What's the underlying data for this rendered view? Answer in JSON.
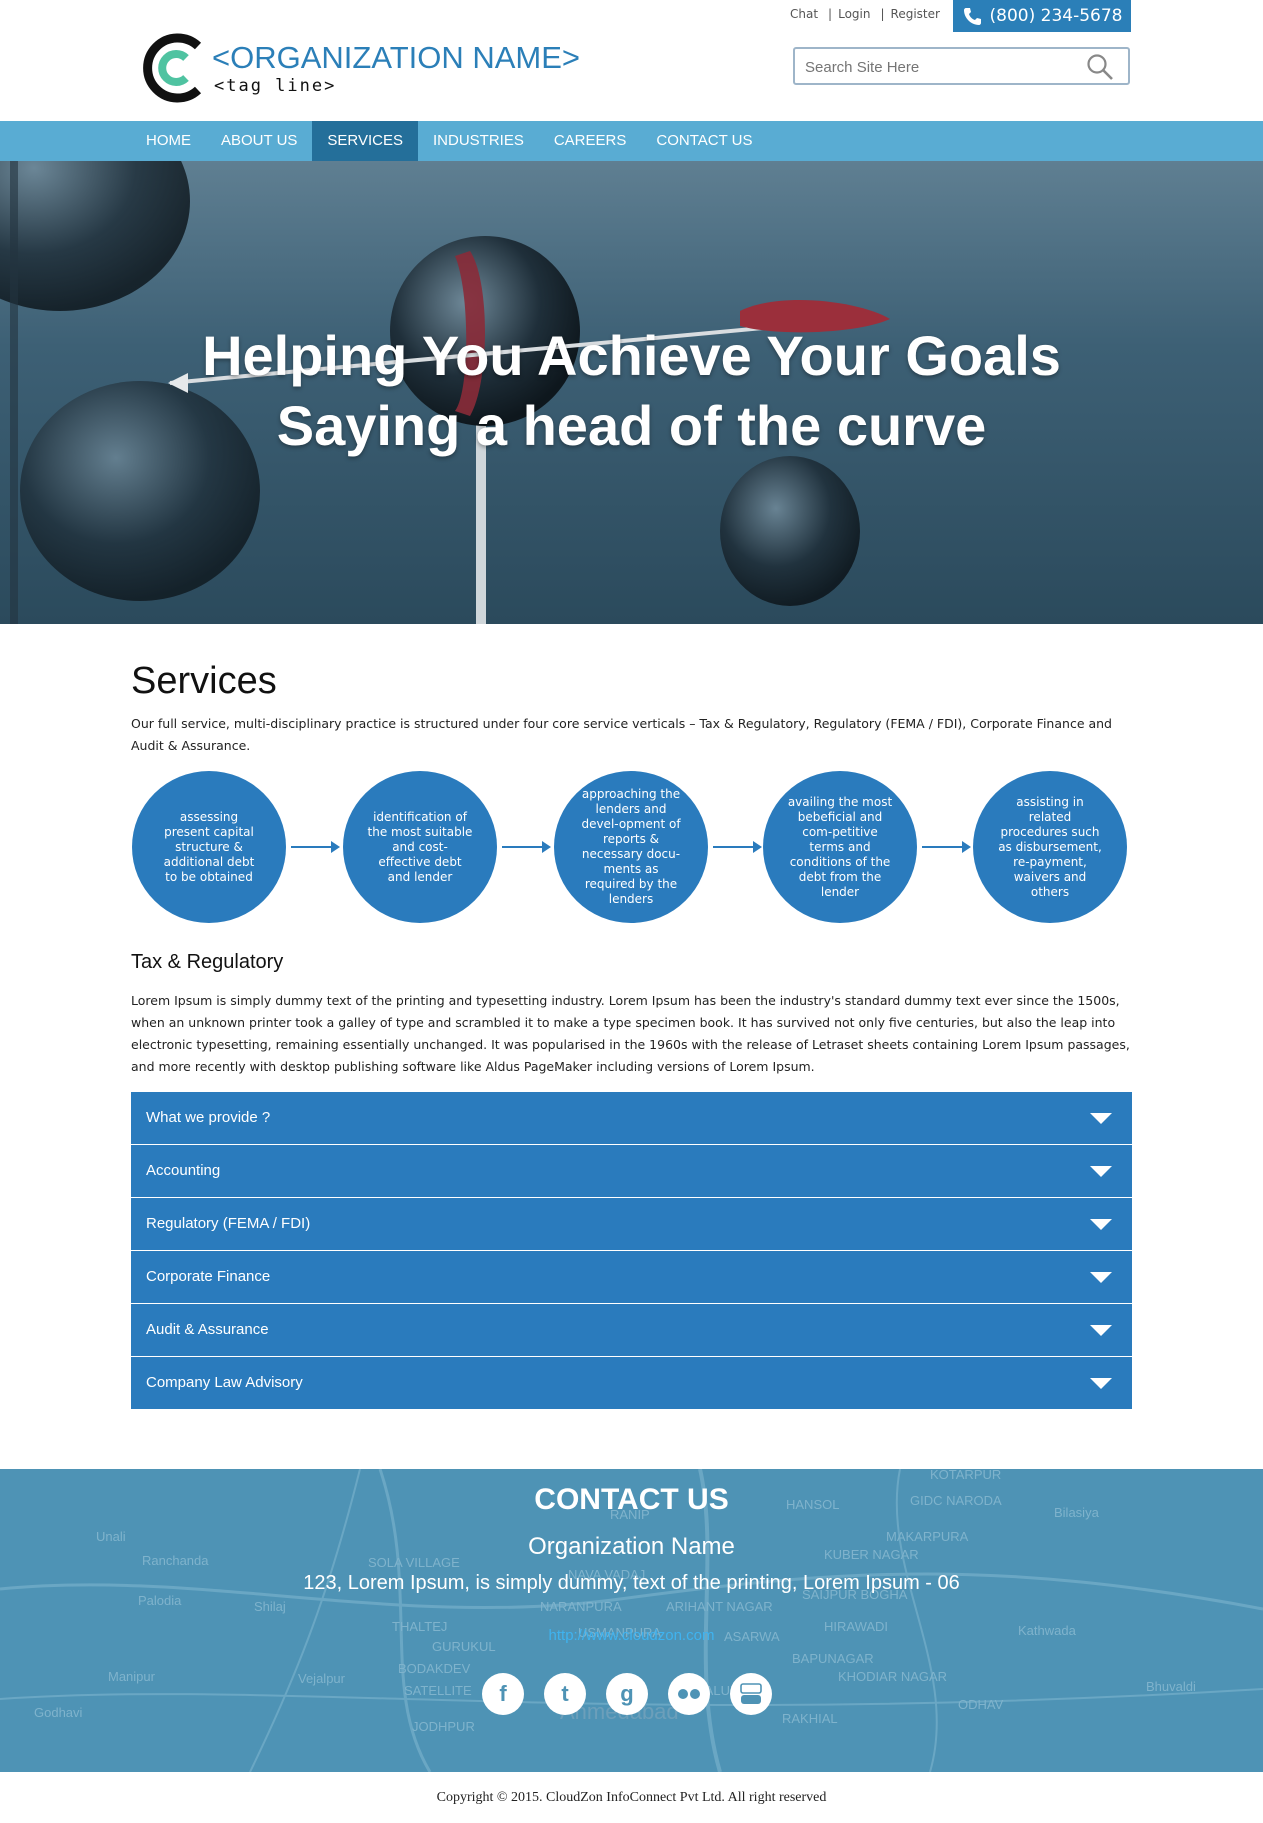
{
  "header": {
    "org_name": "<ORGANIZATION NAME>",
    "tagline": "<tag line>",
    "toplinks": [
      "Chat",
      "Login",
      "Register"
    ],
    "phone": "(800) 234-5678",
    "search_placeholder": "Search Site Here"
  },
  "nav": {
    "items": [
      "HOME",
      "ABOUT US",
      "SERVICES",
      "INDUSTRIES",
      "CAREERS",
      "CONTACT US"
    ],
    "active": "SERVICES"
  },
  "hero": {
    "line1": "Helping You Achieve Your Goals",
    "line2": "Saying a head of the curve"
  },
  "services": {
    "title": "Services",
    "intro": "Our full service, multi-disciplinary practice is structured under four core service verticals – Tax & Regulatory, Regulatory (FEMA / FDI), Corporate Finance and Audit & Assurance.",
    "steps": [
      "assessing present capital structure & additional debt to be obtained",
      "identification of the most suitable and cost-effective debt and lender",
      "approaching the lenders and devel-opment of reports & necessary docu-ments as required by the lenders",
      "availing the most bebeficial and com-petitive terms and conditions of the debt from the lender",
      "assisting in related procedures such as disbursement, re-payment, waivers and others"
    ],
    "subheading": "Tax & Regulatory",
    "body": "Lorem Ipsum is simply dummy text of the printing and typesetting industry. Lorem Ipsum has been the industry's standard dummy text ever since the 1500s, when an unknown printer took a galley of type and scrambled it to make a type specimen book. It has survived not only five centuries, but also the leap into electronic typesetting, remaining essentially unchanged. It was popularised in the 1960s with the release of Letraset sheets containing Lorem Ipsum passages, and more recently with desktop publishing software like Aldus PageMaker including versions of Lorem Ipsum.",
    "accordion": [
      "What we provide ?",
      "Accounting",
      "Regulatory (FEMA / FDI)",
      "Corporate Finance",
      "Audit & Assurance",
      "Company Law Advisory"
    ]
  },
  "contact": {
    "title": "CONTACT US",
    "org": "Organization Name",
    "address": "123, Lorem Ipsum, is simply dummy, text of the printing, Lorem Ipsum - 06",
    "link": "http://www.cloudzon.com",
    "social": [
      "facebook-icon",
      "twitter-icon",
      "google-icon",
      "flickr-icon",
      "youtube-icon"
    ],
    "map_labels": [
      "Unali",
      "Ranchanda",
      "Palodia",
      "Shilaj",
      "Manipur",
      "Vejalpur",
      "Godhavi",
      "SOLA VILLAGE",
      "THALTEJ",
      "GURUKUL",
      "BODAKDEV",
      "SATELLITE",
      "JODHPUR",
      "NARANPURA",
      "USMANPURA",
      "ARIHANT NAGAR",
      "SAIJPUR BOGHA",
      "KUBER NAGAR",
      "MAKARPURA",
      "HANSOL",
      "GIDC NARODA",
      "KOTARPUR",
      "Bilasiya",
      "HIRAWADI",
      "Kathwada",
      "NAVA VADAJ",
      "ASARWA",
      "BAPUNAGAR",
      "KHODIAR NAGAR",
      "ODHAV",
      "RAKHIAL",
      "Bhuvaldi",
      "Ahmedabad",
      "KALUPUR",
      "RANIP"
    ]
  },
  "footer": {
    "copyright": "Copyright © 2015. CloudZon InfoConnect Pvt Ltd. All right reserved"
  },
  "colors": {
    "brand": "#2b7fb8",
    "nav": "#59acd3",
    "nav_active": "#246f9a",
    "accordion": "#2a7bbd",
    "logo_green": "#4fc3a1"
  }
}
